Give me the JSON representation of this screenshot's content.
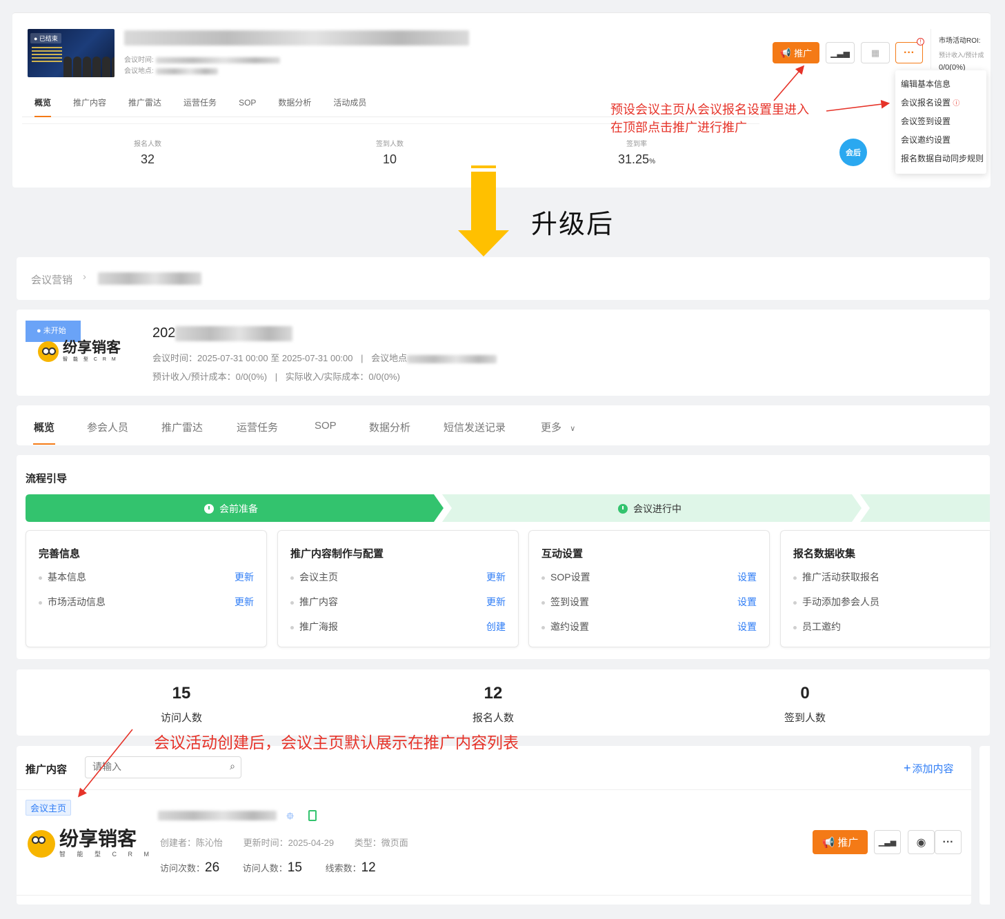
{
  "old": {
    "cover_tag": "● 已结束",
    "meeting_time_label": "会议时间:",
    "meeting_place_label": "会议地点:",
    "promote_label": "推广",
    "more_label": "···",
    "roi_title": "市场活动ROI:",
    "roi_sub": "预计收入/预计成",
    "roi_value": "0/0(0%)",
    "tabs": [
      "概览",
      "推广内容",
      "推广雷达",
      "运营任务",
      "SOP",
      "数据分析",
      "活动成员"
    ],
    "stats": [
      {
        "label": "报名人数",
        "value": "32"
      },
      {
        "label": "签到人数",
        "value": "10"
      },
      {
        "label": "签到率",
        "value": "31.25",
        "unit": "%"
      }
    ],
    "after_badge": "会后",
    "dropdown": [
      "编辑基本信息",
      "会议报名设置",
      "会议签到设置",
      "会议邀约设置",
      "报名数据自动同步规则"
    ],
    "annotation_line1": "预设会议主页从会议报名设置里进入",
    "annotation_line2": "在顶部点击推广进行推广"
  },
  "upgrade_label": "升级后",
  "new": {
    "breadcrumb_root": "会议营销",
    "status_tag": "● 未开始",
    "logo_text": "纷享销客",
    "logo_sub": "智 能 型 C R M",
    "title_prefix": "202",
    "meeting_time": "会议时间：2025-07-31 00:00 至 2025-07-31 00:00",
    "separator": "|",
    "meeting_place_prefix": "会议地点",
    "expected": "预计收入/预计成本：0/0(0%)",
    "actual": "实际收入/实际成本：0/0(0%)",
    "tabs": [
      "概览",
      "参会人员",
      "推广雷达",
      "运营任务",
      "SOP",
      "数据分析",
      "短信发送记录",
      "更多"
    ],
    "flow_title": "流程引导",
    "flow_steps": [
      "会前准备",
      "会议进行中"
    ],
    "cards": [
      {
        "title": "完善信息",
        "rows": [
          {
            "name": "基本信息",
            "action": "更新"
          },
          {
            "name": "市场活动信息",
            "action": "更新"
          }
        ]
      },
      {
        "title": "推广内容制作与配置",
        "rows": [
          {
            "name": "会议主页",
            "action": "更新"
          },
          {
            "name": "推广内容",
            "action": "更新"
          },
          {
            "name": "推广海报",
            "action": "创建"
          }
        ]
      },
      {
        "title": "互动设置",
        "rows": [
          {
            "name": "SOP设置",
            "action": "设置"
          },
          {
            "name": "签到设置",
            "action": "设置"
          },
          {
            "name": "邀约设置",
            "action": "设置"
          }
        ]
      },
      {
        "title": "报名数据收集",
        "rows": [
          {
            "name": "推广活动获取报名",
            "action": ""
          },
          {
            "name": "手动添加参会人员",
            "action": ""
          },
          {
            "name": "员工邀约",
            "action": ""
          }
        ]
      }
    ],
    "metrics": [
      {
        "value": "15",
        "label": "访问人数"
      },
      {
        "value": "12",
        "label": "报名人数"
      },
      {
        "value": "0",
        "label": "签到人数"
      }
    ],
    "annotation": "会议活动创建后，会议主页默认展示在推广内容列表",
    "content_title": "推广内容",
    "search_placeholder": "请输入",
    "add_content": "添加内容",
    "item_tag": "会议主页",
    "creator": "创建者：陈沁怡",
    "updated": "更新时间：2025-04-29",
    "type": "类型：微页面",
    "visits_label": "访问次数：",
    "visits_value": "26",
    "visitors_label": "访问人数：",
    "visitors_value": "15",
    "leads_label": "线索数：",
    "leads_value": "12",
    "promote_label": "推广"
  }
}
